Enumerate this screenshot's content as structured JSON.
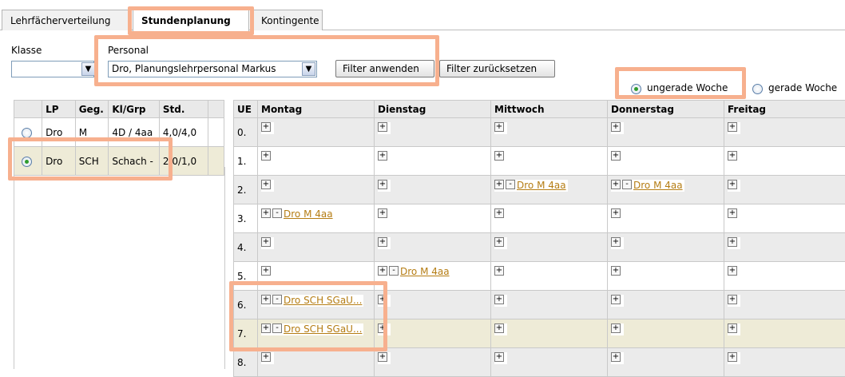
{
  "tabs": [
    {
      "label": "Lehrfächerverteilung",
      "active": false
    },
    {
      "label": "Stundenplanung",
      "active": true
    },
    {
      "label": "Kontingente",
      "active": false
    }
  ],
  "filters": {
    "klasse_label": "Klasse",
    "klasse_value": "",
    "personal_label": "Personal",
    "personal_value": "Dro, Planungslehrpersonal Markus",
    "apply_button": "Filter anwenden",
    "reset_button": "Filter zurücksetzen"
  },
  "week": {
    "odd_label": "ungerade Woche",
    "even_label": "gerade Woche",
    "selected": "odd"
  },
  "assignments": {
    "headers": [
      "LP",
      "Geg.",
      "Kl/Grp",
      "Std."
    ],
    "rows": [
      {
        "lp": "Dro",
        "subject": "M",
        "group": "4D / 4aa",
        "hours": "4,0/4,0",
        "selected": false
      },
      {
        "lp": "Dro",
        "subject": "SCH",
        "group": "Schach -",
        "hours": "2,0/1,0",
        "selected": true
      }
    ]
  },
  "schedule": {
    "headers": [
      "UE",
      "Montag",
      "Dienstag",
      "Mittwoch",
      "Donnerstag",
      "Freitag"
    ],
    "plus_symbol": "+",
    "minus_symbol": "-",
    "rows": [
      {
        "ue": "0.",
        "cells": [
          "",
          "",
          "",
          "",
          ""
        ]
      },
      {
        "ue": "1.",
        "cells": [
          "",
          "",
          "",
          "",
          ""
        ]
      },
      {
        "ue": "2.",
        "cells": [
          "",
          "",
          "Dro M 4aa",
          "Dro M 4aa",
          ""
        ]
      },
      {
        "ue": "3.",
        "cells": [
          "Dro M 4aa",
          "",
          "",
          "",
          ""
        ]
      },
      {
        "ue": "4.",
        "cells": [
          "",
          "",
          "",
          "",
          ""
        ]
      },
      {
        "ue": "5.",
        "cells": [
          "",
          "Dro M 4aa",
          "",
          "",
          ""
        ]
      },
      {
        "ue": "6.",
        "cells": [
          "Dro SCH SGaU...",
          "",
          "",
          "",
          ""
        ]
      },
      {
        "ue": "7.",
        "cells": [
          "Dro SCH SGaU...",
          "",
          "",
          "",
          ""
        ]
      },
      {
        "ue": "8.",
        "cells": [
          "",
          "",
          "",
          "",
          ""
        ]
      }
    ]
  },
  "colors": {
    "highlight": "#f7b08e",
    "link": "#b57d14",
    "selected_row": "#eeebd7",
    "alt_row": "#ebebeb"
  }
}
